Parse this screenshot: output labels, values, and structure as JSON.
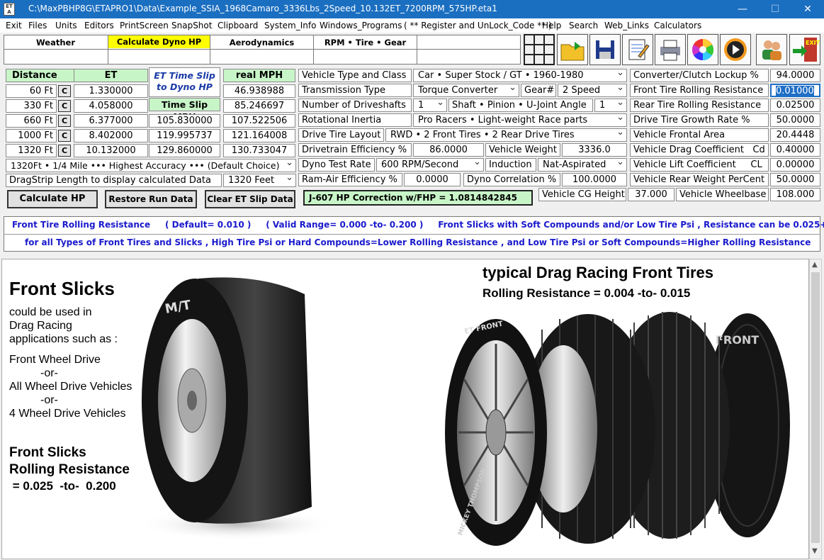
{
  "window": {
    "title": "C:\\MaxPBHP8G\\ETAPRO1\\Data\\Example_SSIA_1968Camaro_3336Lbs_2Speed_10.132ET_7200RPM_575HP.eta1",
    "icon_text": "ET A",
    "minimize": "—",
    "maximize": "☐",
    "close": "✕"
  },
  "menu": [
    "Exit",
    "Files",
    "Units",
    "Editors",
    "PrintScreen",
    "SnapShot",
    "Clipboard",
    "System_Info",
    "Windows_Programs",
    "( ** Register and UnLock_Code ** )",
    "Help",
    "Search",
    "Web_Links",
    "Calculators"
  ],
  "tabs": {
    "weather": "Weather",
    "calc_dyno": "Calculate Dyno HP",
    "aero": "Aerodynamics",
    "rpm": "RPM  •  Tire  •  Gear"
  },
  "colors": {
    "highlight": "#ffff00",
    "green": "#c8f5c8",
    "info_text": "#1a1acd",
    "titlebar": "#1b6fc1"
  },
  "etslip": {
    "col_distance": "Distance",
    "col_et": "ET",
    "col_ts_title": "ET Time Slip to Dyno HP",
    "col_ts_mph": "Time Slip MPH",
    "col_real": "real  MPH",
    "c_label": "C",
    "rows": [
      {
        "dist": "60 Ft",
        "et": "1.330000",
        "ts": "",
        "real": "46.938988"
      },
      {
        "dist": "330 Ft",
        "et": "4.058000",
        "ts": "",
        "real": "85.246697"
      },
      {
        "dist": "660 Ft",
        "et": "6.377000",
        "ts": "105.830000",
        "real": "107.522506"
      },
      {
        "dist": "1000 Ft",
        "et": "8.402000",
        "ts": "119.995737",
        "real": "121.164008"
      },
      {
        "dist": "1320 Ft",
        "et": "10.132000",
        "ts": "129.860000",
        "real": "130.733047"
      }
    ],
    "accuracy": "1320Ft • 1/4 Mile ••• Highest Accuracy ••• (Default Choice)",
    "dragstrip_label": "DragStrip Length to display calculated Data",
    "dragstrip_val": "1320 Feet"
  },
  "buttons": {
    "calc": "Calculate  HP",
    "restore": "Restore Run Data",
    "clear": "Clear ET Slip Data"
  },
  "j607": "J-607 HP Correction w/FHP = 1.0814842845",
  "vehicle": {
    "type_label": "Vehicle Type and Class",
    "type_val": "Car  •  Super Stock / GT  •  1960-1980",
    "trans_label": "Transmission Type",
    "trans_val": "Torque Converter",
    "gear_label": "Gear#",
    "gear_val": "2  Speed",
    "drv_label": "Number of Driveshafts",
    "drv_val": "1",
    "shaft_label": "Shaft • Pinion • U-Joint Angle",
    "shaft_val": "1",
    "rot_label": "Rotational Inertia",
    "rot_val": "Pro Racers  •  Light-weight Race parts",
    "layout_label": "Drive Tire Layout",
    "layout_val": "RWD • 2  Front Tires  •  2  Rear Drive Tires",
    "eff_label": "Drivetrain Efficiency %",
    "eff_val": "86.0000",
    "weight_label": "Vehicle Weight",
    "weight_val": "3336.0",
    "dyno_label": "Dyno Test Rate",
    "dyno_val": "600 RPM/Second",
    "ind_label": "Induction",
    "ind_val": "Nat-Aspirated",
    "ram_label": "Ram-Air Efficiency %",
    "ram_val": "0.0000",
    "corr_label": "Dyno Correlation %",
    "corr_val": "100.0000",
    "cg_label": "Vehicle CG Height",
    "cg_val": "37.000",
    "wb_label": "Vehicle Wheelbase",
    "wb_val": "108.000"
  },
  "right": [
    {
      "label": "Converter/Clutch Lockup %",
      "val": "94.0000"
    },
    {
      "label": "Front Tire Rolling Resistance",
      "val": "0.01000"
    },
    {
      "label": "Rear Tire Rolling Resistance",
      "val": "0.02500"
    },
    {
      "label": "Drive Tire Growth Rate %",
      "val": "50.0000"
    },
    {
      "label": "Vehicle Frontal Area",
      "val": "20.4448"
    },
    {
      "label": "Vehicle Drag Coefficient   Cd",
      "val": "0.40000"
    },
    {
      "label": "Vehicle Lift Coefficient     CL",
      "val": "0.00000"
    },
    {
      "label": "Vehicle Rear Weight PerCent",
      "val": "50.0000"
    }
  ],
  "info": {
    "line1": "Front Tire Rolling Resistance     ( Default= 0.010 )     ( Valid Range= 0.000 -to- 0.200 )     Front Slicks with Soft Compounds and/or Low Tire Psi , Resistance can be 0.025+",
    "line2": "for all Types of Front Tires and Slicks ,  High Tire Psi or Hard Compounds=Lower Rolling Resistance ,  and  Low Tire Psi or Soft Compounds=Higher Rolling Resistance"
  },
  "content": {
    "h1": "Front Slicks",
    "p1": "could be used in",
    "p2": "Drag Racing",
    "p3": "applications such as :",
    "a1": "Front Wheel Drive",
    "or1": "-or-",
    "a2": "All Wheel Drive Vehicles",
    "or2": "-or-",
    "a3": "4  Wheel Drive Vehicles",
    "rr1": "Front Slicks",
    "rr2": "Rolling Resistance",
    "rr3": " = 0.025  -to-  0.200",
    "t1": "typical Drag Racing Front Tires",
    "t2": "Rolling Resistance =  0.004  -to-  0.015",
    "tire_brand": "M/T",
    "tire_front": "ET FRONT",
    "tire_front2": "FRONT",
    "tire_thompson": "MICKEY THOMPSON"
  }
}
